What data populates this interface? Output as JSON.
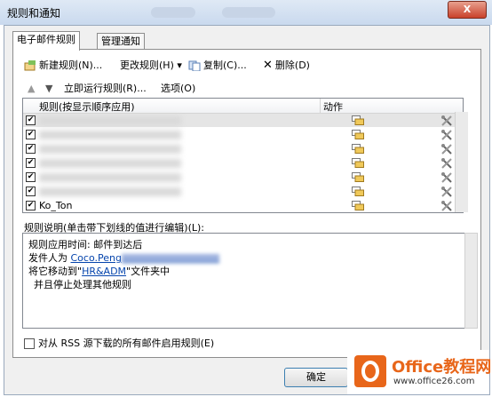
{
  "window": {
    "title": "规则和通知",
    "close_label": "X"
  },
  "tabs": [
    {
      "label": "电子邮件规则",
      "active": true
    },
    {
      "label": "管理通知",
      "active": false
    }
  ],
  "toolbar": {
    "new_rule": "新建规则(N)...",
    "change_rule": "更改规则(H) ▾",
    "copy": "复制(C)...",
    "delete": "删除(D)",
    "run_now": "立即运行规则(R)...",
    "options": "选项(O)"
  },
  "rules_list": {
    "col_rule": "规则(按显示顺序应用)",
    "col_action": "动作",
    "rows": [
      {
        "name": "",
        "checked": true,
        "selected": true
      },
      {
        "name": "",
        "checked": true,
        "selected": false
      },
      {
        "name": "",
        "checked": true,
        "selected": false
      },
      {
        "name": "",
        "checked": true,
        "selected": false
      },
      {
        "name": "",
        "checked": true,
        "selected": false
      },
      {
        "name": "",
        "checked": true,
        "selected": false
      },
      {
        "name": "Ko_Ton",
        "checked": true,
        "selected": false
      }
    ]
  },
  "description": {
    "label": "规则说明(单击带下划线的值进行编辑)(L):",
    "line1": "规则应用时间: 邮件到达后",
    "line2_prefix": "发件人为 ",
    "line2_link": "Coco.Peng",
    "line3_prefix": "将它移动到\"",
    "line3_link": "HR&ADM",
    "line3_suffix": "\"文件夹中",
    "line4": "并且停止处理其他规则"
  },
  "rss_option": "对从 RSS 源下载的所有邮件启用规则(E)",
  "buttons": {
    "ok": "确定"
  },
  "watermark": {
    "brand": "Office教程网",
    "url": "www.office26.com"
  },
  "colors": {
    "accent": "#3c7fb1",
    "link": "#0645ad",
    "brand_orange": "#e8661a"
  }
}
